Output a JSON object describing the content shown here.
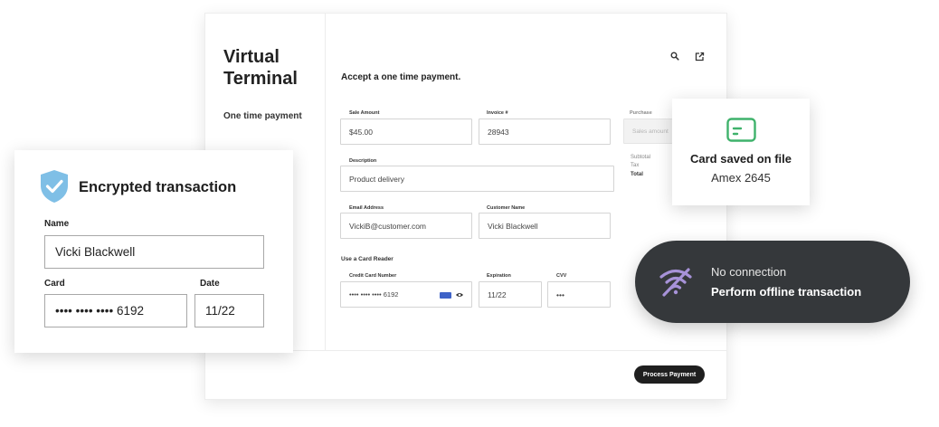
{
  "terminal": {
    "title": "Virtual Terminal",
    "sidebar_item": "One time payment",
    "toolbar": {
      "search_icon": "search-icon",
      "export_icon": "export-icon"
    },
    "form_heading": "Accept a one time payment.",
    "sale_amount": {
      "label": "Sale Amount",
      "value": "$45.00"
    },
    "invoice": {
      "label": "Invoice #",
      "value": "28943"
    },
    "purchase": {
      "label": "Purchase",
      "placeholder": "Sales amount"
    },
    "description": {
      "label": "Description",
      "value": "Product delivery"
    },
    "summary": {
      "subtotal": "Subtotal",
      "tax": "Tax",
      "total": "Total"
    },
    "email": {
      "label": "Email Address",
      "value": "VickiB@customer.com"
    },
    "customer_name": {
      "label": "Customer Name",
      "value": "Vicki Blackwell"
    },
    "card_reader_label": "Use a Card Reader",
    "credit_card": {
      "label": "Credit Card Number",
      "value": "•••• •••• •••• 6192"
    },
    "expiration": {
      "label": "Expiration",
      "value": "11/22"
    },
    "cvv": {
      "label": "CVV",
      "value": "•••"
    },
    "process_button": "Process Payment"
  },
  "encrypted_card": {
    "title": "Encrypted transaction",
    "icon": "shield-check-icon",
    "name_label": "Name",
    "name_value": "Vicki Blackwell",
    "card_label": "Card",
    "card_value": "•••• •••• •••• 6192",
    "date_label": "Date",
    "date_value": "11/22"
  },
  "saved_card": {
    "icon": "card-icon",
    "title": "Card saved on file",
    "subtitle": "Amex 2645"
  },
  "offline": {
    "icon": "wifi-off-icon",
    "line1": "No connection",
    "line2": "Perform offline transaction"
  },
  "colors": {
    "shield": "#7fbfe6",
    "card_icon": "#3fb26b",
    "wifi_off": "#a792d8",
    "pill_bg": "#35383b",
    "button_bg": "#1f1f1f"
  }
}
